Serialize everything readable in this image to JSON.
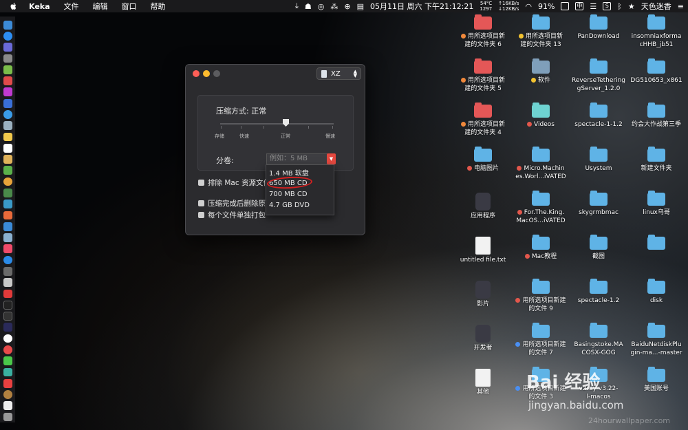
{
  "menubar": {
    "app_name": "Keka",
    "items": [
      "文件",
      "编辑",
      "窗口",
      "帮助"
    ],
    "temp": "54°C",
    "fan": "1297",
    "net_up": "↑16KB/s",
    "net_down": "↓12KB/s",
    "clock": "05月11日 周六 下午21:12:21",
    "battery": "91%",
    "input_method": "中",
    "user": "天色迷香"
  },
  "keka": {
    "format": "XZ",
    "compress_label": "压缩方式: 正常",
    "tick_labels": [
      "存储",
      "快速",
      "正常",
      "慢速"
    ],
    "split_label": "分卷:",
    "split_placeholder": "例如：5 MB",
    "checkboxes": [
      "排除 Mac 资源文件",
      "压缩完成后删除原文件",
      "每个文件单独打包"
    ],
    "dropdown": [
      "1.4 MB 软盘",
      "650 MB CD",
      "700 MB CD",
      "4.7 GB DVD"
    ]
  },
  "desktop": {
    "col1": [
      {
        "label1": "用所选项目新",
        "label2": "建的文件夹 6",
        "color": "red",
        "tag": "orange"
      },
      {
        "label1": "用所选项目新",
        "label2": "建的文件夹 5",
        "color": "red",
        "tag": "orange"
      },
      {
        "label1": "用所选项目新",
        "label2": "建的文件夹 4",
        "color": "red",
        "tag": "orange"
      },
      {
        "label1": "电脑图片",
        "label2": "",
        "color": "blue",
        "tag": "red"
      },
      {
        "label1": "应用程序",
        "label2": "",
        "color": "app",
        "tag": ""
      },
      {
        "label1": "untitled file.txt",
        "label2": "",
        "color": "doc",
        "tag": ""
      },
      {
        "label1": "影片",
        "label2": "",
        "color": "app",
        "tag": ""
      },
      {
        "label1": "开发者",
        "label2": "",
        "color": "app",
        "tag": ""
      },
      {
        "label1": "其他",
        "label2": "",
        "color": "doc",
        "tag": ""
      }
    ],
    "col2": [
      {
        "label1": "用所选项目新",
        "label2": "建的文件夹 13",
        "color": "blue",
        "tag": "yellow"
      },
      {
        "label1": "软件",
        "label2": "",
        "color": "gray",
        "tag": "yellow"
      },
      {
        "label1": "Videos",
        "label2": "",
        "color": "teal",
        "tag": "red"
      },
      {
        "label1": "Micro.Machin",
        "label2": "es.Worl...iVATED",
        "color": "blue",
        "tag": "red"
      },
      {
        "label1": "For.The.King.",
        "label2": "MacOS...iVATED",
        "color": "blue",
        "tag": "red"
      },
      {
        "label1": "Mac教程",
        "label2": "",
        "color": "blue",
        "tag": "red"
      },
      {
        "label1": "用所选项目新建",
        "label2": "的文件 9",
        "color": "blue",
        "tag": "red"
      },
      {
        "label1": "用所选项目新建",
        "label2": "的文件 7",
        "color": "blue",
        "tag": "blue"
      },
      {
        "label1": "用所选项目新建",
        "label2": "的文件 3",
        "color": "blue",
        "tag": "blue"
      }
    ],
    "col3": [
      {
        "label1": "PanDownload",
        "label2": "",
        "color": "blue",
        "tag": ""
      },
      {
        "label1": "ReverseTethering",
        "label2": "gServer_1.2.0",
        "color": "blue",
        "tag": ""
      },
      {
        "label1": "spectacle-1-1.2",
        "label2": "",
        "color": "blue",
        "tag": ""
      },
      {
        "label1": "Usystem",
        "label2": "",
        "color": "blue",
        "tag": ""
      },
      {
        "label1": "skygrmbmac",
        "label2": "",
        "color": "blue",
        "tag": ""
      },
      {
        "label1": "截图",
        "label2": "",
        "color": "blue",
        "tag": ""
      },
      {
        "label1": "spectacle-1.2",
        "label2": "",
        "color": "blue",
        "tag": ""
      },
      {
        "label1": "Basingstoke.MA",
        "label2": "COSX-GOG",
        "color": "blue",
        "tag": ""
      },
      {
        "label1": "v2ray-v3.22-",
        "label2": "l-macos",
        "color": "blue",
        "tag": ""
      }
    ],
    "col4": [
      {
        "label1": "insomniaxforma",
        "label2": "cHHB_jb51",
        "color": "blue",
        "tag": ""
      },
      {
        "label1": "DG510653_x861",
        "label2": "",
        "color": "blue",
        "tag": ""
      },
      {
        "label1": "约会大作战第三季",
        "label2": "",
        "color": "blue",
        "tag": ""
      },
      {
        "label1": "新建文件夹",
        "label2": "",
        "color": "blue",
        "tag": ""
      },
      {
        "label1": "linux乌哥",
        "label2": "",
        "color": "blue",
        "tag": ""
      },
      {
        "label1": "",
        "label2": "",
        "color": "blue",
        "tag": ""
      },
      {
        "label1": "disk",
        "label2": "",
        "color": "blue",
        "tag": ""
      },
      {
        "label1": "BaiduNetdiskPlu",
        "label2": "gin-ma...-master",
        "color": "blue",
        "tag": ""
      },
      {
        "label1": "美国账号",
        "label2": "",
        "color": "blue",
        "tag": ""
      }
    ]
  },
  "watermark": {
    "brand": "Bai 经验",
    "url": "jingyan.baidu.com",
    "credit": "24hourwallpaper.com"
  }
}
